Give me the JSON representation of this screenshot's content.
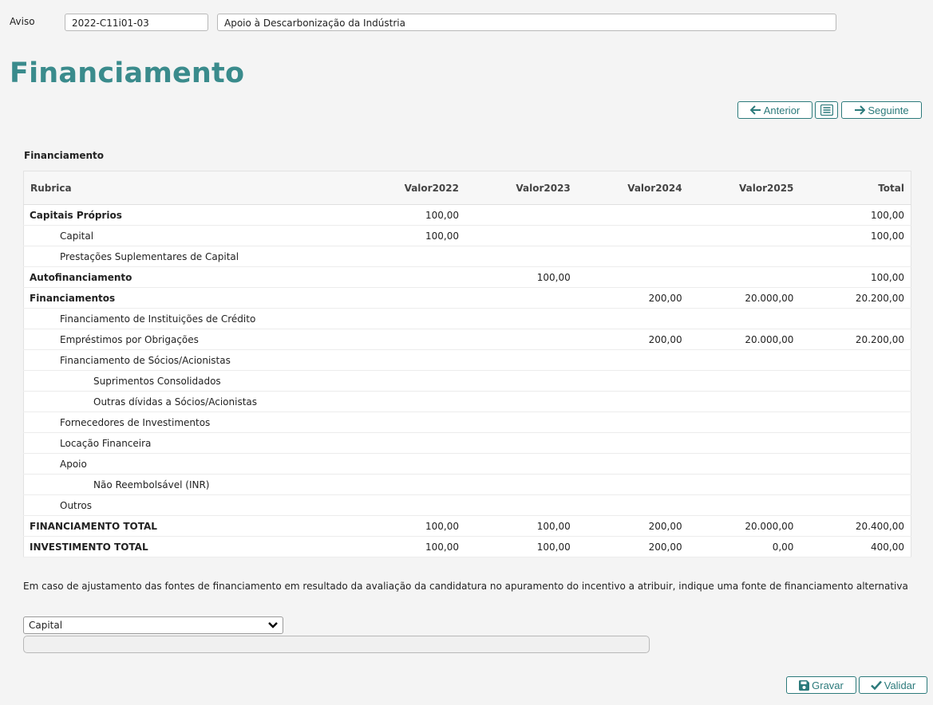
{
  "header": {
    "aviso_label": "Aviso",
    "aviso_code": "2022-C11i01-03",
    "aviso_title": "Apoio à Descarbonização da Indústria"
  },
  "page_title": "Financiamento",
  "nav": {
    "prev_label": "Anterior",
    "next_label": "Seguinte"
  },
  "section_label": "Financiamento",
  "table": {
    "columns": [
      "Rubrica",
      "Valor2022",
      "Valor2023",
      "Valor2024",
      "Valor2025",
      "Total"
    ],
    "rows": [
      {
        "label": "Capitais Próprios",
        "level": 0,
        "bold": true,
        "values": [
          "100,00",
          "",
          "",
          "",
          "100,00"
        ]
      },
      {
        "label": "Capital",
        "level": 1,
        "bold": false,
        "values": [
          "100,00",
          "",
          "",
          "",
          "100,00"
        ]
      },
      {
        "label": "Prestações Suplementares de Capital",
        "level": 1,
        "bold": false,
        "values": [
          "",
          "",
          "",
          "",
          ""
        ]
      },
      {
        "label": "Autofinanciamento",
        "level": 0,
        "bold": true,
        "values": [
          "",
          "100,00",
          "",
          "",
          "100,00"
        ]
      },
      {
        "label": "Financiamentos",
        "level": 0,
        "bold": true,
        "values": [
          "",
          "",
          "200,00",
          "20.000,00",
          "20.200,00"
        ]
      },
      {
        "label": "Financiamento de Instituições de Crédito",
        "level": 1,
        "bold": false,
        "values": [
          "",
          "",
          "",
          "",
          ""
        ]
      },
      {
        "label": "Empréstimos por Obrigações",
        "level": 1,
        "bold": false,
        "values": [
          "",
          "",
          "200,00",
          "20.000,00",
          "20.200,00"
        ]
      },
      {
        "label": "Financiamento de Sócios/Acionistas",
        "level": 1,
        "bold": false,
        "values": [
          "",
          "",
          "",
          "",
          ""
        ]
      },
      {
        "label": "Suprimentos Consolidados",
        "level": 2,
        "bold": false,
        "values": [
          "",
          "",
          "",
          "",
          ""
        ]
      },
      {
        "label": "Outras dívidas a Sócios/Acionistas",
        "level": 2,
        "bold": false,
        "values": [
          "",
          "",
          "",
          "",
          ""
        ]
      },
      {
        "label": "Fornecedores de Investimentos",
        "level": 1,
        "bold": false,
        "values": [
          "",
          "",
          "",
          "",
          ""
        ]
      },
      {
        "label": "Locação Financeira",
        "level": 1,
        "bold": false,
        "values": [
          "",
          "",
          "",
          "",
          ""
        ]
      },
      {
        "label": "Apoio",
        "level": 1,
        "bold": false,
        "values": [
          "",
          "",
          "",
          "",
          ""
        ]
      },
      {
        "label": "Não Reembolsável (INR)",
        "level": 2,
        "bold": false,
        "values": [
          "",
          "",
          "",
          "",
          ""
        ]
      },
      {
        "label": "Outros",
        "level": 1,
        "bold": false,
        "values": [
          "",
          "",
          "",
          "",
          ""
        ]
      },
      {
        "label": "FINANCIAMENTO TOTAL",
        "level": 0,
        "bold": true,
        "values": [
          "100,00",
          "100,00",
          "200,00",
          "20.000,00",
          "20.400,00"
        ]
      },
      {
        "label": "INVESTIMENTO TOTAL",
        "level": 0,
        "bold": true,
        "values": [
          "100,00",
          "100,00",
          "200,00",
          "0,00",
          "400,00"
        ]
      }
    ]
  },
  "alt_note": "Em caso de ajustamento das fontes de financiamento em resultado da avaliação da candidatura no apuramento do incentivo a atribuir, indique uma fonte de financiamento alternativa",
  "alt_select": {
    "selected": "Capital"
  },
  "alt_text_value": "",
  "actions": {
    "save_label": "Gravar",
    "validate_label": "Validar"
  },
  "colors": {
    "accent": "#2c7a7b",
    "title": "#3a8b8c"
  }
}
